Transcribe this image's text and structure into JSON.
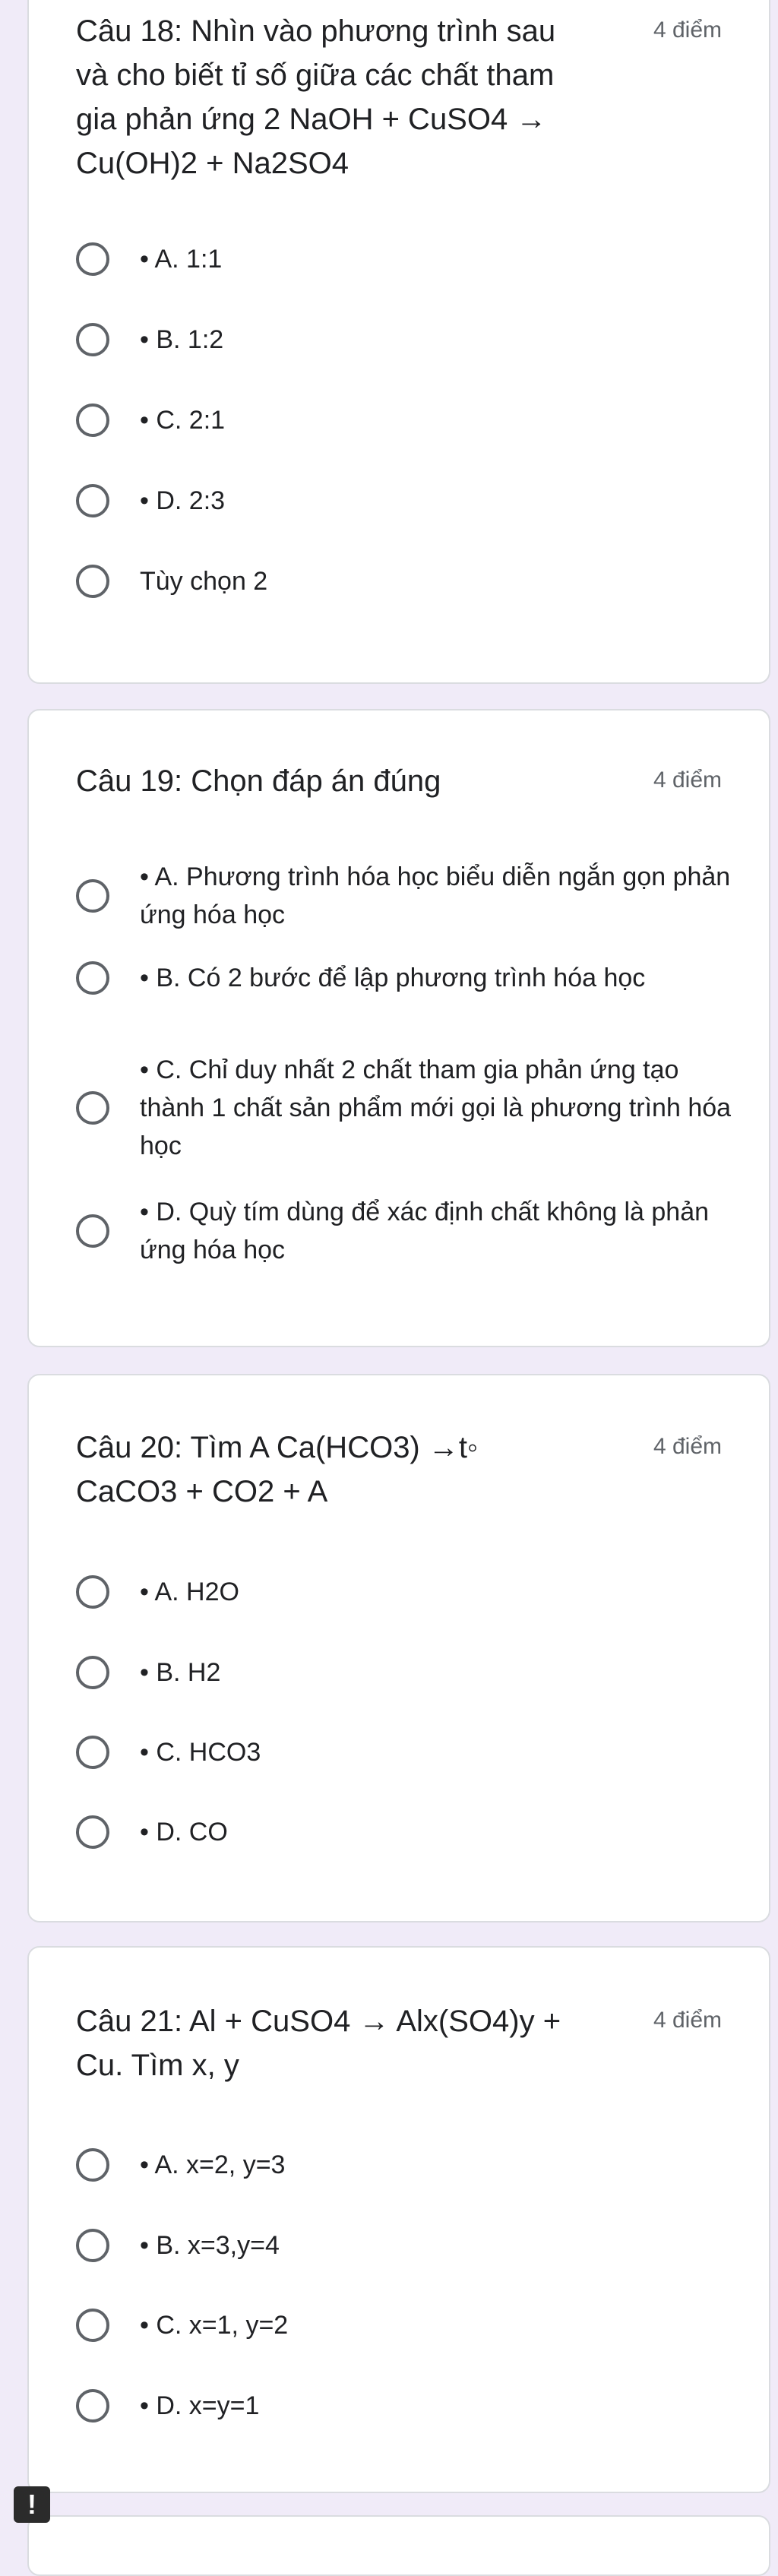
{
  "questions": [
    {
      "title": "Câu 18: Nhìn vào phương trình sau và cho biết tỉ số giữa các chất tham gia phản ứng 2 NaOH + CuSO4 → Cu(OH)2 + Na2SO4",
      "points": "4 điểm",
      "options": [
        "• A. 1:1",
        "• B. 1:2",
        "• C. 2:1",
        "• D. 2:3",
        "Tùy chọn 2"
      ]
    },
    {
      "title": "Câu 19: Chọn đáp án đúng",
      "points": "4 điểm",
      "options": [
        "• A. Phương trình hóa học biểu diễn ngắn gọn phản ứng hóa học",
        "• B. Có 2 bước để lập phương trình hóa học",
        "• C. Chỉ duy nhất 2 chất tham gia phản ứng tạo thành 1 chất sản phẩm mới gọi là phương trình hóa học",
        "• D. Quỳ tím dùng để xác định chất không là phản ứng hóa học"
      ]
    },
    {
      "title": "Câu 20: Tìm A Ca(HCO3) →t◦ CaCO3 + CO2 + A",
      "points": "4 điểm",
      "options": [
        "• A. H2O",
        "• B. H2",
        "• C. HCO3",
        "• D. CO"
      ]
    },
    {
      "title": "Câu 21: Al + CuSO4 → Alx(SO4)y + Cu. Tìm x, y",
      "points": "4 điểm",
      "options": [
        "• A. x=2, y=3",
        "• B. x=3,y=4",
        "• C. x=1, y=2",
        "• D. x=y=1"
      ]
    }
  ],
  "alert_icon": "!"
}
